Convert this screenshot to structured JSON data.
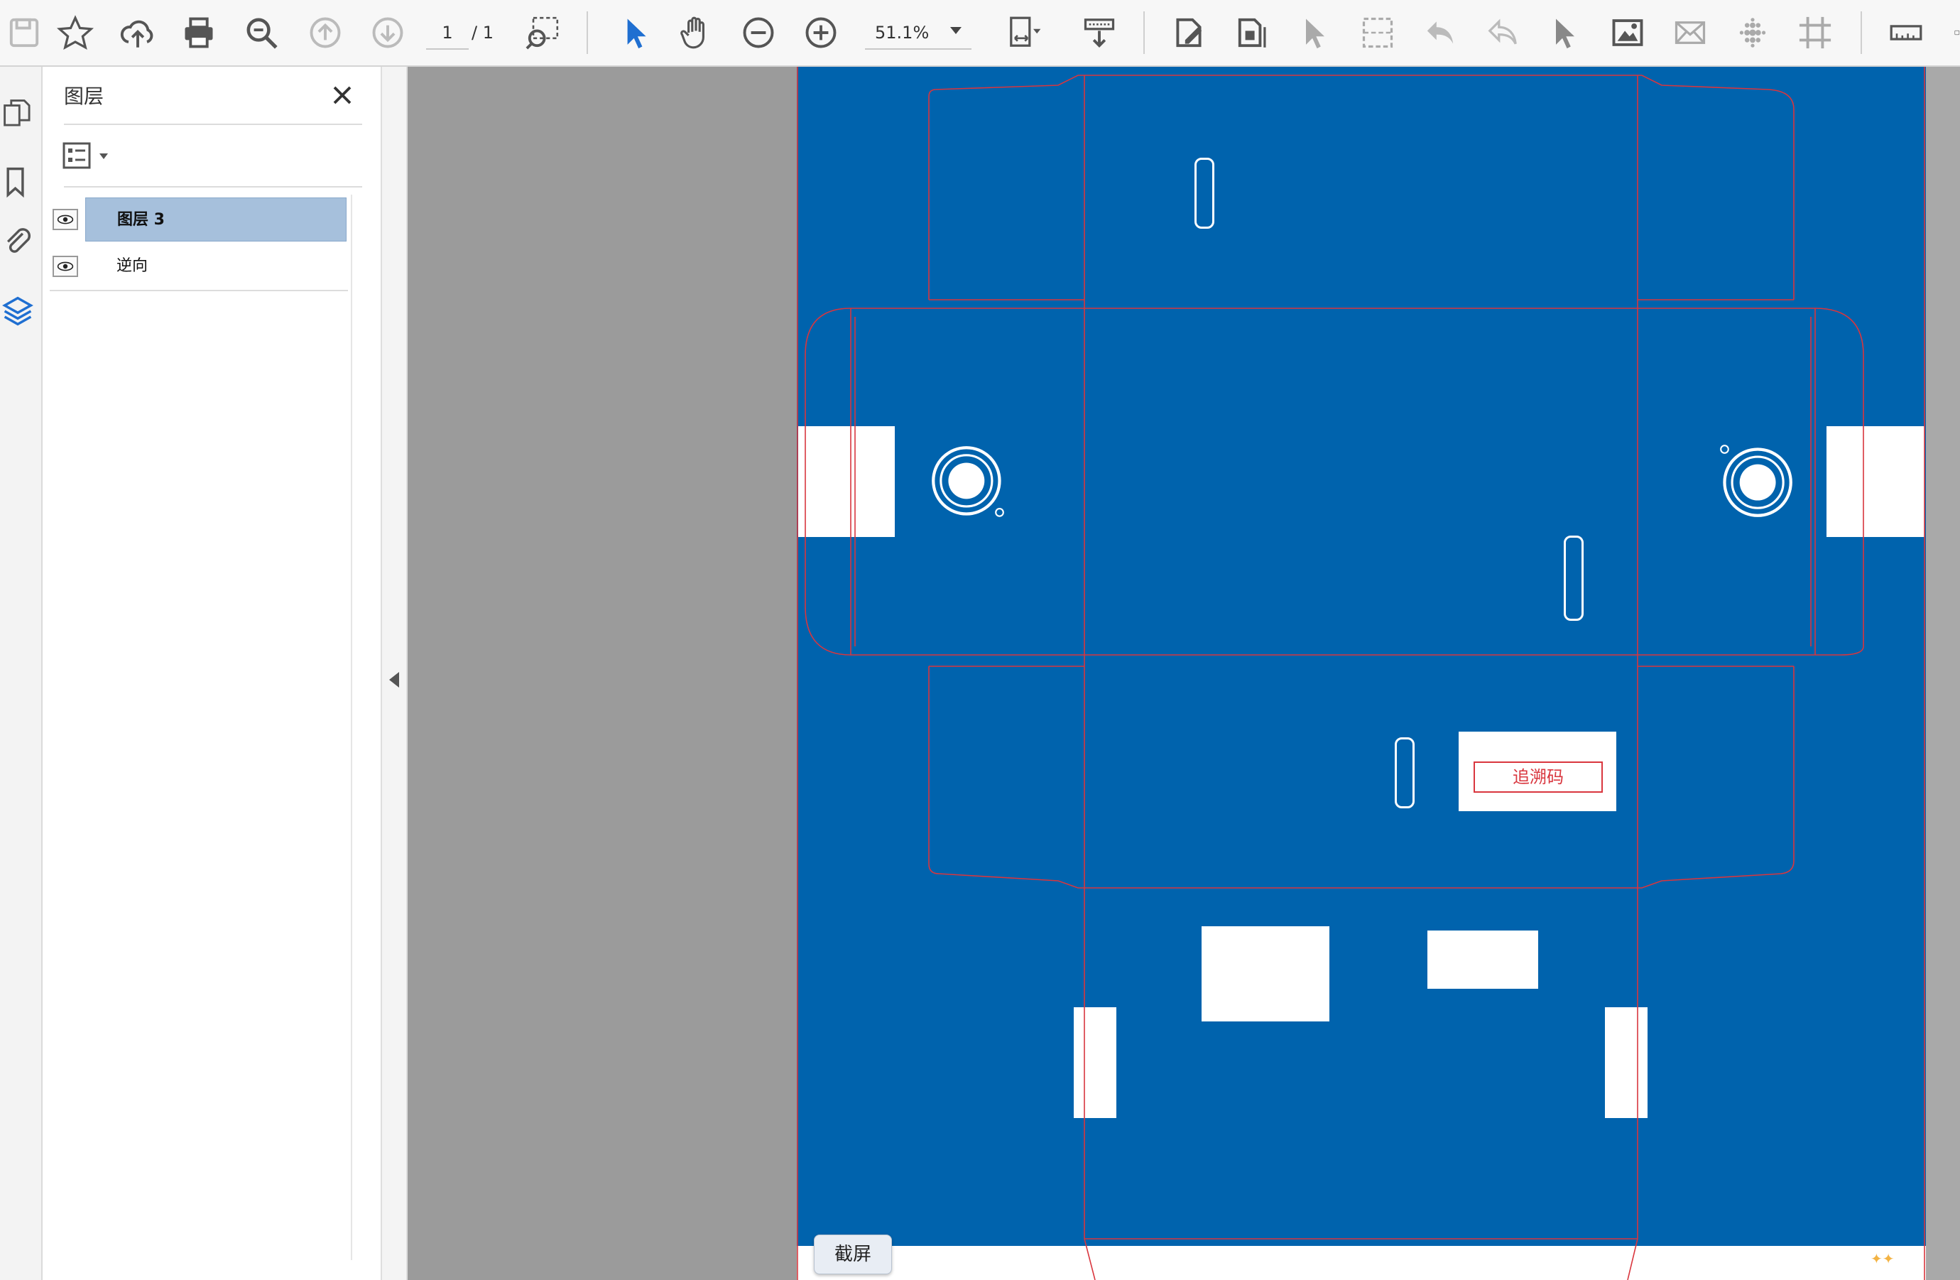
{
  "toolbar": {
    "page_current": "1",
    "page_total": "/ 1",
    "zoom": "51.1%",
    "icons": [
      "save-icon",
      "bookmark-star-icon",
      "cloud-upload-icon",
      "print-icon",
      "zoom-search-icon",
      "page-up-icon",
      "page-down-icon",
      "marquee-zoom-icon",
      "select-arrow-icon",
      "hand-icon",
      "zoom-out-icon",
      "zoom-in-icon",
      "fit-page-icon",
      "scroll-mode-icon",
      "edit-text-icon",
      "edit-object-icon",
      "select-object-icon",
      "crop-grid-icon",
      "undo-icon",
      "redo-icon",
      "pointer-icon",
      "image-icon",
      "envelope-icon",
      "halftone-icon",
      "trim-marks-icon",
      "ruler-icon",
      "panel-icon"
    ]
  },
  "layers_panel": {
    "title": "图层",
    "layers": [
      {
        "name": "图层 3",
        "selected": true,
        "visible": true
      },
      {
        "name": "逆向",
        "selected": false,
        "visible": true
      }
    ]
  },
  "document": {
    "background_color": "#0063ad",
    "dieline_color": "#d9363e",
    "trace_code_label": "追溯码"
  },
  "tooltip": {
    "text": "截屏"
  },
  "colors": {
    "accent": "#1f6fd1",
    "selected_row": "#a6c0dc"
  }
}
